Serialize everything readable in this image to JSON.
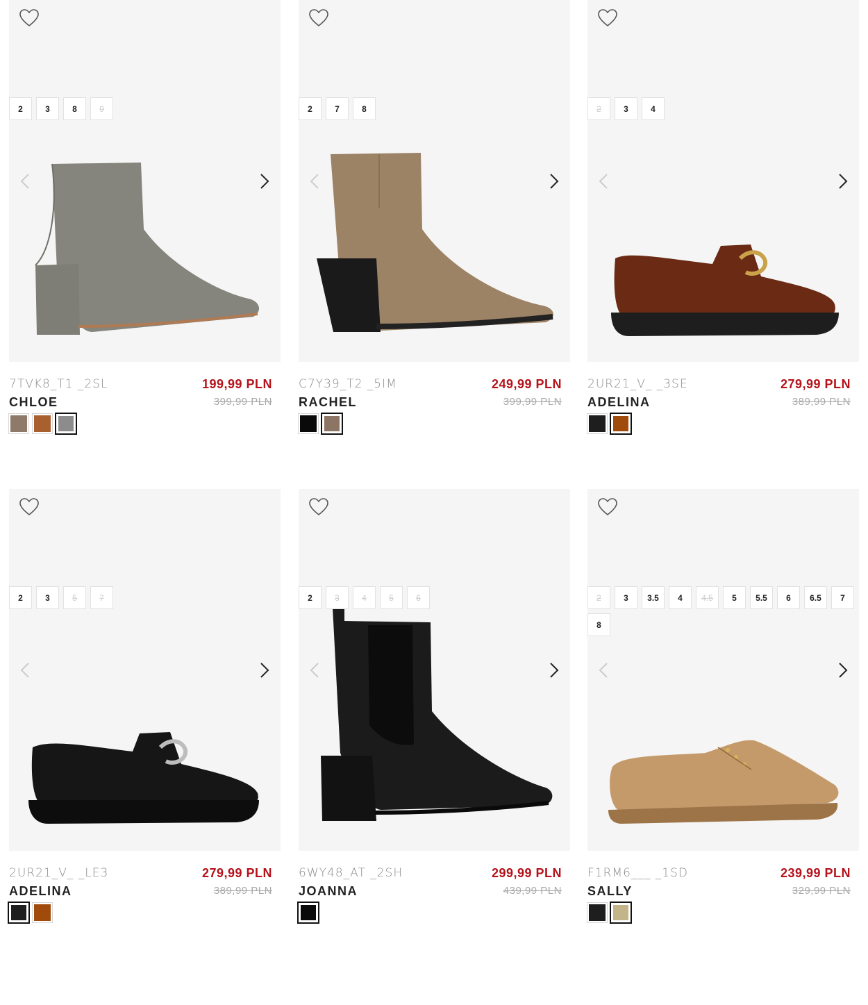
{
  "products": [
    {
      "sku": "7TVK8_T1 _2SL",
      "name": "CHLOE",
      "price": "199,99 PLN",
      "old_price": "399,99 PLN",
      "image_icon": "ankle-boot-gray-suede",
      "colors": [
        {
          "hex": "#8f7a6a",
          "selected": false
        },
        {
          "hex": "#a8602f",
          "selected": false
        },
        {
          "hex": "#8c8c8c",
          "selected": true
        }
      ],
      "sizes": [
        {
          "label": "2",
          "available": true
        },
        {
          "label": "3",
          "available": true
        },
        {
          "label": "8",
          "available": true
        },
        {
          "label": "9",
          "available": false
        }
      ]
    },
    {
      "sku": "C7Y39_T2 _5IM",
      "name": "RACHEL",
      "price": "249,99 PLN",
      "old_price": "399,99 PLN",
      "image_icon": "ankle-boot-tan-suede",
      "colors": [
        {
          "hex": "#0a0a0a",
          "selected": false
        },
        {
          "hex": "#8c7565",
          "selected": true
        }
      ],
      "sizes": [
        {
          "label": "2",
          "available": true
        },
        {
          "label": "7",
          "available": true
        },
        {
          "label": "8",
          "available": true
        }
      ]
    },
    {
      "sku": "2UR21_V_ _3SE",
      "name": "ADELINA",
      "price": "279,99 PLN",
      "old_price": "389,99 PLN",
      "image_icon": "loafer-brown-chain",
      "colors": [
        {
          "hex": "#1e1e1e",
          "selected": false
        },
        {
          "hex": "#a04a0c",
          "selected": true
        }
      ],
      "sizes": [
        {
          "label": "2",
          "available": false
        },
        {
          "label": "3",
          "available": true
        },
        {
          "label": "4",
          "available": true
        }
      ]
    },
    {
      "sku": "2UR21_V_ _LE3",
      "name": "ADELINA",
      "price": "279,99 PLN",
      "old_price": "389,99 PLN",
      "image_icon": "loafer-black-chain",
      "colors": [
        {
          "hex": "#1e1e1e",
          "selected": true
        },
        {
          "hex": "#a04a0c",
          "selected": false
        }
      ],
      "sizes": [
        {
          "label": "2",
          "available": true
        },
        {
          "label": "3",
          "available": true
        },
        {
          "label": "5",
          "available": false
        },
        {
          "label": "7",
          "available": false
        }
      ]
    },
    {
      "sku": "6WY48_AT _2SH",
      "name": "JOANNA",
      "price": "299,99 PLN",
      "old_price": "439,99 PLN",
      "image_icon": "chelsea-boot-black",
      "colors": [
        {
          "hex": "#0a0a0a",
          "selected": true
        }
      ],
      "sizes": [
        {
          "label": "2",
          "available": true
        },
        {
          "label": "3",
          "available": false
        },
        {
          "label": "4",
          "available": false
        },
        {
          "label": "5",
          "available": false
        },
        {
          "label": "6",
          "available": false
        }
      ]
    },
    {
      "sku": "F1RM6___ _1SD",
      "name": "SALLY",
      "price": "239,99 PLN",
      "old_price": "329,99 PLN",
      "image_icon": "derby-shoe-beige",
      "colors": [
        {
          "hex": "#1e1e1e",
          "selected": false
        },
        {
          "hex": "#c4b48a",
          "selected": true
        }
      ],
      "sizes": [
        {
          "label": "2",
          "available": false
        },
        {
          "label": "3",
          "available": true
        },
        {
          "label": "3.5",
          "available": true
        },
        {
          "label": "4",
          "available": true
        },
        {
          "label": "4.5",
          "available": false
        },
        {
          "label": "5",
          "available": true
        },
        {
          "label": "5.5",
          "available": true
        },
        {
          "label": "6",
          "available": true
        },
        {
          "label": "6.5",
          "available": true
        },
        {
          "label": "7",
          "available": true
        },
        {
          "label": "8",
          "available": true
        }
      ]
    }
  ]
}
